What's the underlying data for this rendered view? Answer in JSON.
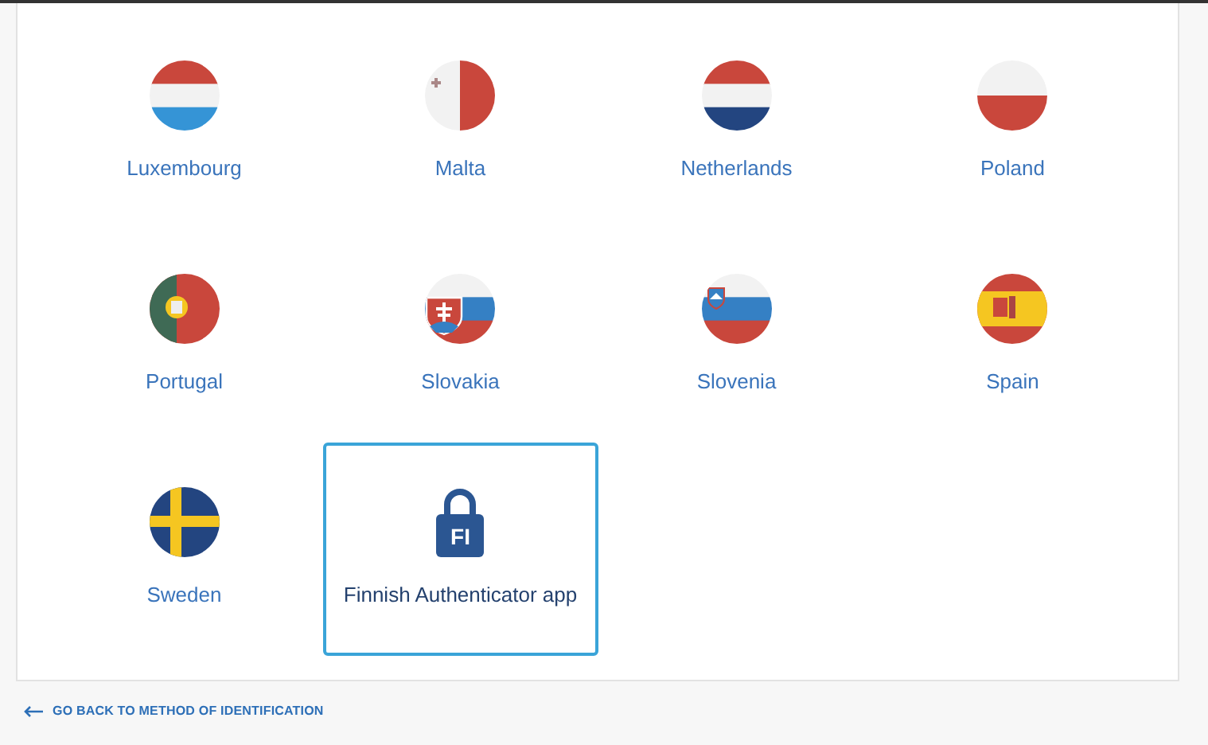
{
  "options": [
    {
      "kind": "flag",
      "label": "Luxembourg",
      "selected": false
    },
    {
      "kind": "flag",
      "label": "Malta",
      "selected": false
    },
    {
      "kind": "flag",
      "label": "Netherlands",
      "selected": false
    },
    {
      "kind": "flag",
      "label": "Poland",
      "selected": false
    },
    {
      "kind": "flag",
      "label": "Portugal",
      "selected": false
    },
    {
      "kind": "flag",
      "label": "Slovakia",
      "selected": false
    },
    {
      "kind": "flag",
      "label": "Slovenia",
      "selected": false
    },
    {
      "kind": "flag",
      "label": "Spain",
      "selected": false
    },
    {
      "kind": "flag",
      "label": "Sweden",
      "selected": false
    },
    {
      "kind": "app",
      "label": "Finnish Authenticator app",
      "badge": "FI",
      "selected": true
    }
  ],
  "back_link": "GO BACK TO METHOD OF IDENTIFICATION"
}
